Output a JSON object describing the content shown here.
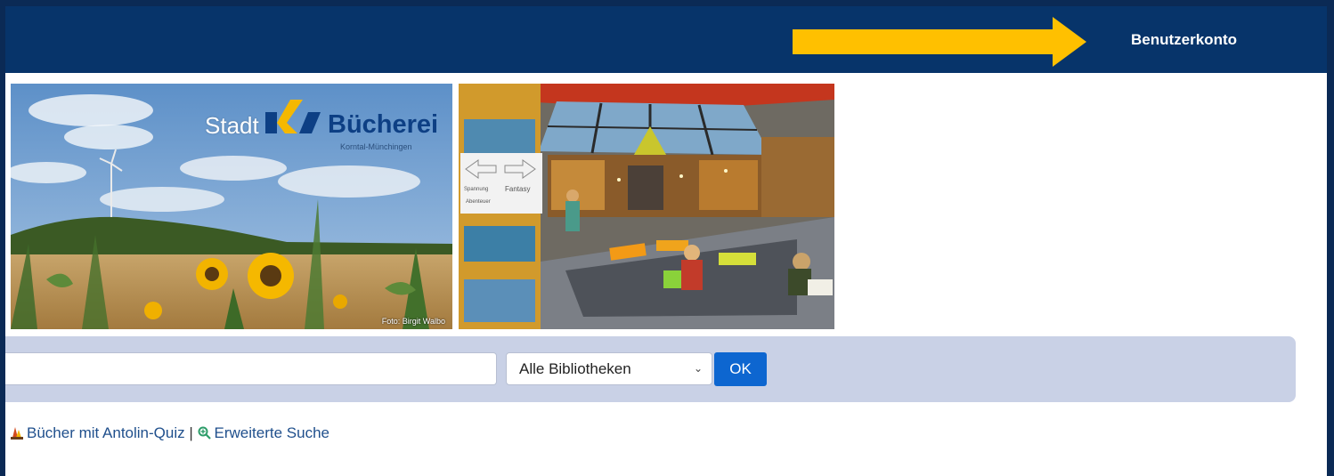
{
  "header": {
    "account_label": "Benutzerkonto",
    "arrow_color": "#ffc000",
    "background_color": "#07346a"
  },
  "banner": {
    "logo_stadt": "Stadt",
    "logo_name": "Bücherei",
    "logo_subtitle": "Korntal-Münchingen",
    "photo_credit": "Foto: Birgit Walbo",
    "shelf_signs": [
      "Spannung",
      "Fantasy",
      "Abenteuer"
    ]
  },
  "search": {
    "query_value": "",
    "library_selected": "Alle Bibliotheken",
    "ok_label": "OK",
    "panel_color": "#c9d1e6",
    "button_color": "#0d66d0"
  },
  "links": {
    "antolin_icon": "antolin-icon",
    "antolin_label": "Bücher mit Antolin-Quiz",
    "separator": "|",
    "advanced_icon": "magnifier-plus-icon",
    "advanced_label": "Erweiterte Suche"
  }
}
